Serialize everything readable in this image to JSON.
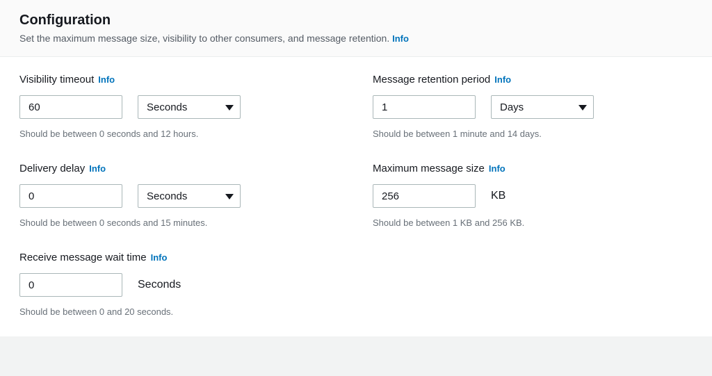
{
  "header": {
    "title": "Configuration",
    "description": "Set the maximum message size, visibility to other consumers, and message retention.",
    "info": "Info"
  },
  "info_label": "Info",
  "fields": {
    "visibility": {
      "label": "Visibility timeout",
      "value": "60",
      "unit": "Seconds",
      "helper": "Should be between 0 seconds and 12 hours."
    },
    "retention": {
      "label": "Message retention period",
      "value": "1",
      "unit": "Days",
      "helper": "Should be between 1 minute and 14 days."
    },
    "delay": {
      "label": "Delivery delay",
      "value": "0",
      "unit": "Seconds",
      "helper": "Should be between 0 seconds and 15 minutes."
    },
    "maxsize": {
      "label": "Maximum message size",
      "value": "256",
      "unit": "KB",
      "helper": "Should be between 1 KB and 256 KB."
    },
    "waittime": {
      "label": "Receive message wait time",
      "value": "0",
      "unit": "Seconds",
      "helper": "Should be between 0 and 20 seconds."
    }
  }
}
